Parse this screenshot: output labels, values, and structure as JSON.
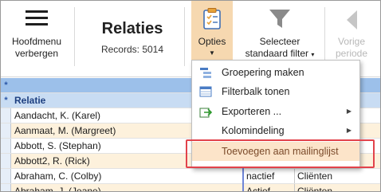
{
  "ribbon": {
    "hoofdmenu_label": "Hoofdmenu verbergen",
    "title": "Relaties",
    "records": "Records: 5014",
    "opties_label": "Opties",
    "filter_label_1": "Selecteer",
    "filter_label_2": "standaard filter",
    "vorige_label_1": "Vorige",
    "vorige_label_2": "periode"
  },
  "grid": {
    "header_star_1": "*",
    "header_star_2": "*",
    "column_header": "Relatie",
    "rows": [
      {
        "name": "Aandacht, K. (Karel)",
        "status": "",
        "category": ""
      },
      {
        "name": "Aanmaat, M. (Margreet)",
        "status": "",
        "category": ""
      },
      {
        "name": "Abbott, S. (Stephan)",
        "status": "",
        "category": ""
      },
      {
        "name": "Abbott2, R. (Rick)",
        "status": "",
        "category": ""
      },
      {
        "name": "Abraham, C. (Colby)",
        "status": "nactief",
        "category": "Cliënten"
      },
      {
        "name": "Abraham, J. (Jeane)",
        "status": "Actief",
        "category": "Cliënten"
      }
    ]
  },
  "menu": {
    "items": [
      {
        "label": "Groepering maken",
        "icon": "group-icon"
      },
      {
        "label": "Filterbalk tonen",
        "icon": "filterbar-icon"
      },
      {
        "label": "Exporteren ...",
        "icon": "export-icon"
      },
      {
        "label": "Kolomindeling",
        "icon": ""
      },
      {
        "label": "Toevoegen aan mailinglijst",
        "icon": ""
      }
    ]
  },
  "colors": {
    "accent_orange": "#f6d8b0",
    "highlight": "#fce4c9",
    "header_blue": "#9cc0ea",
    "red_outline": "#e2434b"
  }
}
